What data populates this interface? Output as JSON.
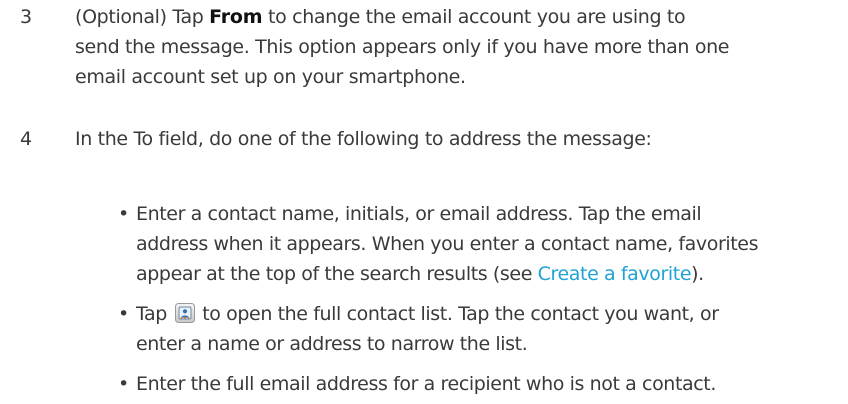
{
  "steps": [
    {
      "number": "3",
      "lines": [
        {
          "pre": "(Optional) Tap ",
          "bold": "From",
          "post": " to change the email account you are using to"
        },
        {
          "text": "send the message. This option appears only if you have more than one"
        },
        {
          "text": "email account set up on your smartphone."
        }
      ]
    },
    {
      "number": "4",
      "lines": [
        {
          "text": "In the To field, do one of the following to address the message:"
        }
      ]
    }
  ],
  "bullets": [
    {
      "glyph": "•",
      "lines": [
        {
          "text": "Enter a contact name, initials, or email address. Tap the email"
        },
        {
          "text": "address when it appears. When you enter a contact name, favorites"
        },
        {
          "pre": "appear at the top of the search results (see ",
          "link": "Create a favorite",
          "post": ")."
        }
      ]
    },
    {
      "glyph": "•",
      "lines": [
        {
          "pre": "Tap ",
          "icon": "contacts-picker-icon",
          "post": " to open the full contact list. Tap the contact you want, or"
        },
        {
          "text": "enter a name or address to narrow the list."
        }
      ]
    },
    {
      "glyph": "•",
      "lines": [
        {
          "text": "Enter the full email address for a recipient who is not a contact."
        }
      ]
    }
  ]
}
